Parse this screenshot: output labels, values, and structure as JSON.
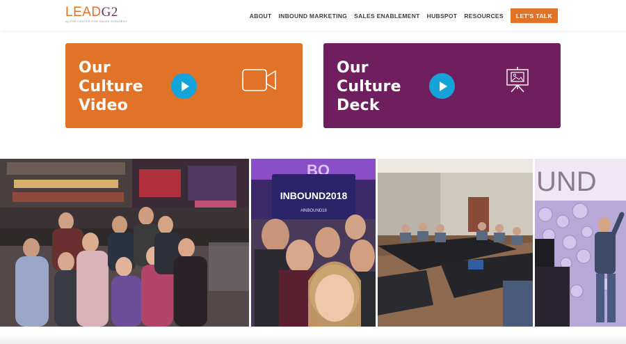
{
  "brand": {
    "logo_text": "LEADG2",
    "tagline": "by THE CENTER FOR SALES STRATEGY"
  },
  "nav": {
    "items": [
      "ABOUT",
      "INBOUND MARKETING",
      "SALES ENABLEMENT",
      "HUBSPOT",
      "RESOURCES"
    ],
    "cta_label": "LET'S TALK"
  },
  "cards": {
    "video": {
      "line1": "Our",
      "line2": "Culture",
      "line3": "Video",
      "icon": "video-camera-icon",
      "color": "#e07327"
    },
    "deck": {
      "line1": "Our",
      "line2": "Culture",
      "line3": "Deck",
      "icon": "presentation-icon",
      "color": "#701f5e"
    }
  },
  "photos": {
    "photo2_banner_main": "INBOUND2018",
    "photo2_banner_tag": "#INBOUND18",
    "photo4_sign": "UND"
  },
  "colors": {
    "accent": "#e07327",
    "purple": "#701f5e",
    "play": "#16a3d9"
  }
}
